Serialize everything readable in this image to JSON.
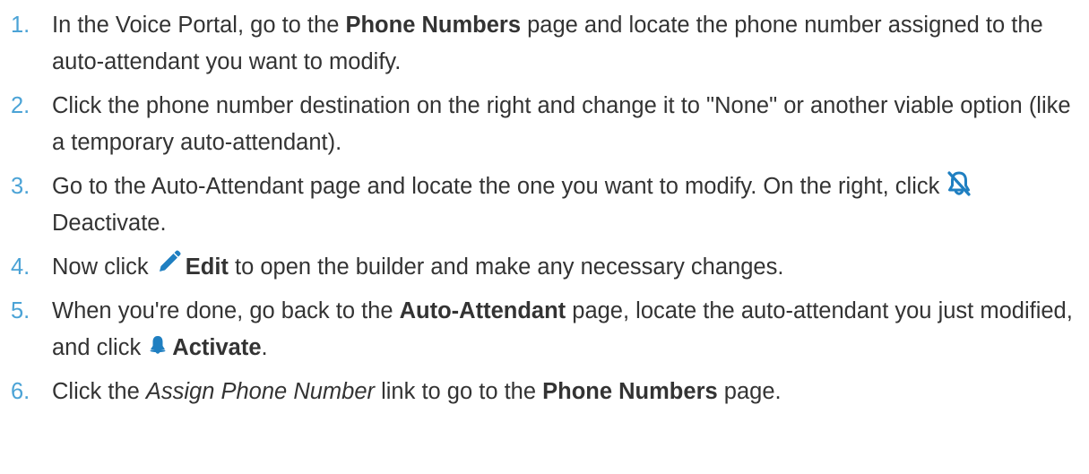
{
  "steps": [
    {
      "num": "1.",
      "t1": "In the Voice Portal, go to the ",
      "b1": "Phone Numbers",
      "t2": " page and locate the phone number assigned to the auto-attendant you want to modify."
    },
    {
      "num": "2.",
      "t1": "Click the phone number destination on the right and change it to \"None\" or another viable option (like a temporary auto-attendant)."
    },
    {
      "num": "3.",
      "t1": "Go to the Auto-Attendant page and locate the one you want to modify. On the right, click ",
      "icon": "deactivate-icon",
      "link": "Deactivate",
      "t2": "."
    },
    {
      "num": "4.",
      "t1": "Now click ",
      "icon": "pencil-icon",
      "b1": "Edit",
      "t2": " to open the builder and make any necessary changes."
    },
    {
      "num": "5.",
      "t1": "When you're done, go back to the ",
      "b1": "Auto-Attendant",
      "t2": " page, locate the auto-attendant you just modified, and click ",
      "icon": "activate-icon",
      "b2": "Activate",
      "t3": "."
    },
    {
      "num": "6.",
      "t1": "Click the ",
      "i1": "Assign Phone Number",
      "t2": " link to go to the ",
      "b1": "Phone Numbers",
      "t3": " page."
    }
  ],
  "colors": {
    "step_number": "#4ba3d6",
    "body_text": "#333333",
    "icon_blue": "#1f7fc1"
  }
}
